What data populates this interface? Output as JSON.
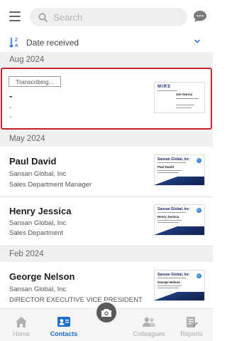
{
  "search": {
    "placeholder": "Search"
  },
  "sort": {
    "label": "Date received"
  },
  "sections": [
    {
      "label": "Aug 2024"
    },
    {
      "label": "May 2024"
    },
    {
      "label": "Feb 2024"
    }
  ],
  "pending": {
    "status": "Transcribing...",
    "name": "-",
    "company": "-",
    "title": "-",
    "card": {
      "logo": "MIRS",
      "person": "Joe Garcia"
    }
  },
  "contacts": [
    {
      "name": "Paul David",
      "company": "Sansan Global, Inc",
      "title": "Sales Department Manager",
      "card": {
        "logo": "Sansan Global, Inc",
        "person": "Paul David"
      }
    },
    {
      "name": "Henry Jessica",
      "company": "Sansan Global, Inc",
      "title": "Sales Department",
      "card": {
        "logo": "Sansan Global, Inc",
        "person": "Henry Jessica"
      }
    },
    {
      "name": "George Nelson",
      "company": "Sansan Global, Inc",
      "title": "DIRECTOR EXECUTIVE VICE PRESIDENT",
      "card": {
        "logo": "Sansan Global, Inc",
        "person": "George Nelson"
      }
    }
  ],
  "tabs": [
    {
      "label": "Home",
      "icon": "home-icon",
      "active": false
    },
    {
      "label": "Contacts",
      "icon": "contacts-icon",
      "active": true
    },
    {
      "label": "",
      "icon": "camera-icon",
      "active": false
    },
    {
      "label": "Colleagues",
      "icon": "colleagues-icon",
      "active": false
    },
    {
      "label": "Reports",
      "icon": "reports-icon",
      "active": false
    }
  ],
  "colors": {
    "accent": "#1f6fd1",
    "highlight": "#c6262e",
    "card_navy": "#1d3a7a"
  }
}
